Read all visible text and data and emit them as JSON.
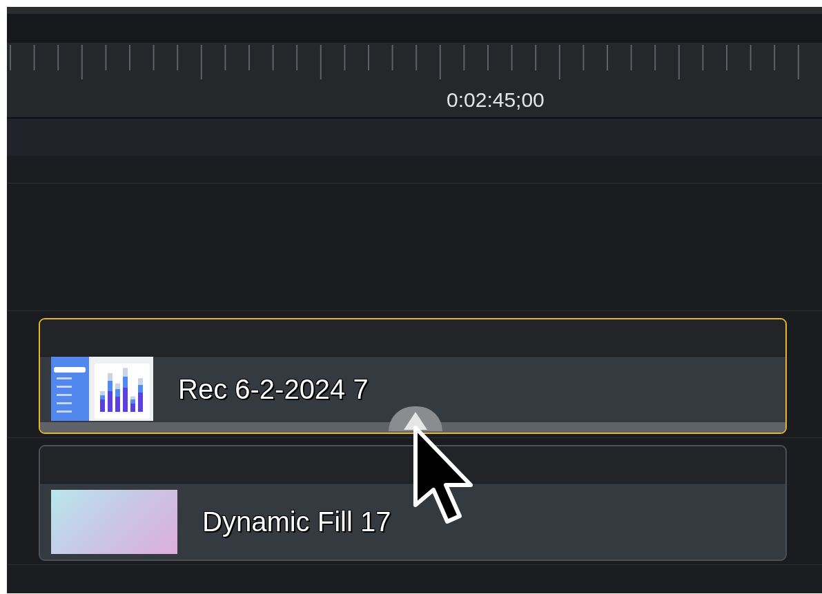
{
  "ruler": {
    "timecode": "0:02:45;00"
  },
  "tracks": [
    {
      "clip": {
        "title": "Rec 6-2-2024 7",
        "selected": true,
        "thumbnail": {
          "kind": "recording"
        }
      }
    },
    {
      "clip": {
        "title": "Dynamic Fill 17",
        "selected": false,
        "thumbnail": {
          "kind": "fill"
        }
      }
    }
  ],
  "cursor": {
    "kind": "arrow"
  }
}
